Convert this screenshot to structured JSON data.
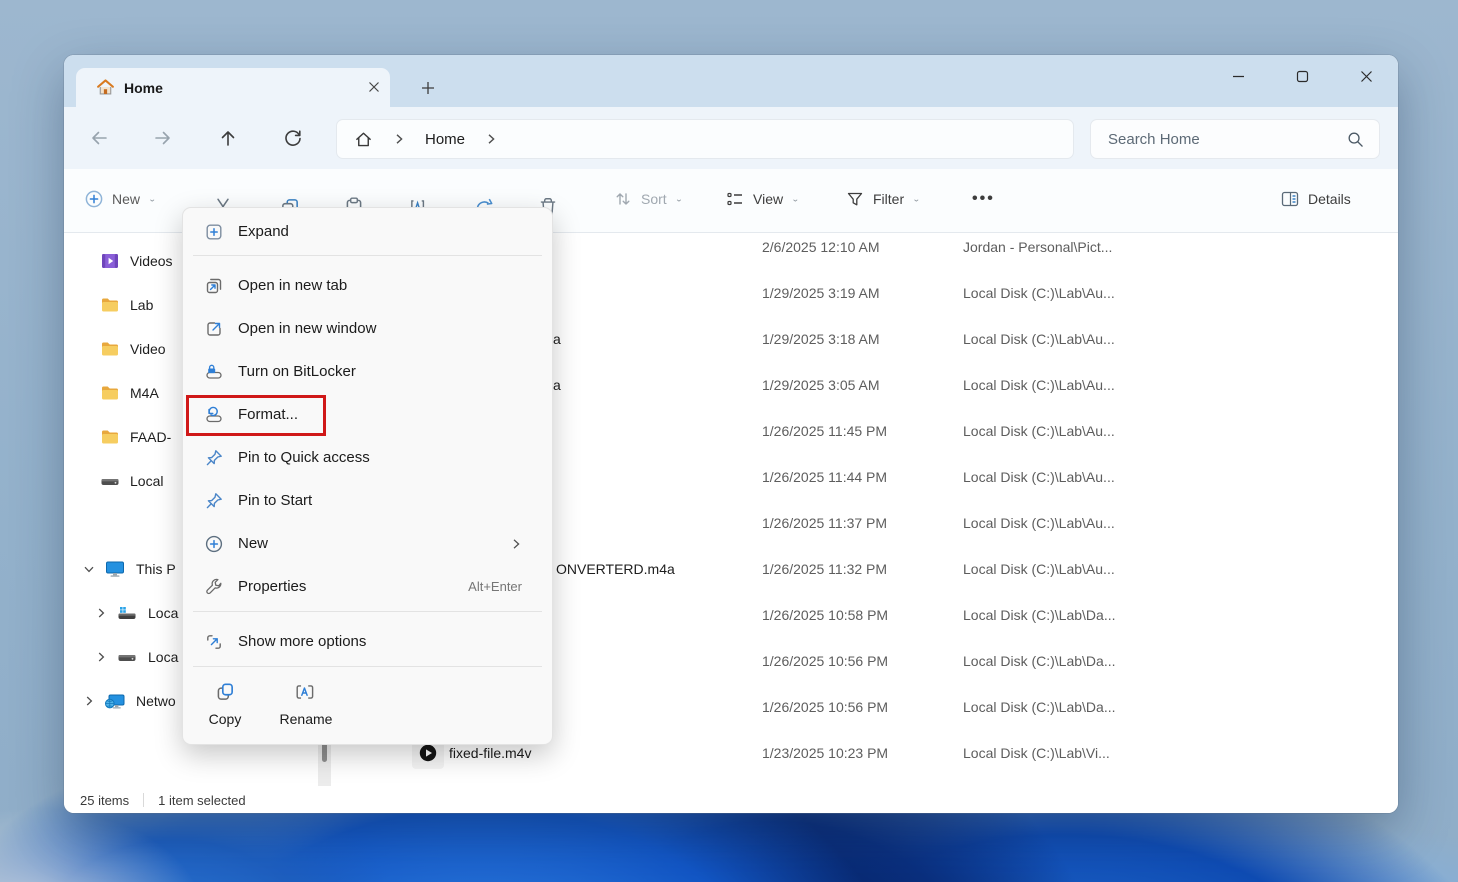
{
  "colors": {
    "accent_blue": "#2f7fd6",
    "highlight_red": "#d01818",
    "folder_yellow": "#f6cd60"
  },
  "titlebar": {
    "tab_label": "Home"
  },
  "navbar": {
    "breadcrumb_root": "Home",
    "search_placeholder": "Search Home"
  },
  "toolbar": {
    "new_label": "New",
    "sort_label": "Sort",
    "view_label": "View",
    "filter_label": "Filter",
    "more_label": "•••",
    "details_label": "Details"
  },
  "sidebar": {
    "items": [
      {
        "label": "Videos",
        "icon": "videos"
      },
      {
        "label": "Lab",
        "icon": "folder"
      },
      {
        "label": "Video",
        "icon": "folder"
      },
      {
        "label": "M4A",
        "icon": "folder"
      },
      {
        "label": "FAAD-",
        "icon": "folder"
      },
      {
        "label": "Local",
        "icon": "drive"
      },
      {
        "label": "This P",
        "icon": "this-pc"
      },
      {
        "label": "Loca",
        "icon": "drive-os"
      },
      {
        "label": "Loca",
        "icon": "drive"
      },
      {
        "label": "Netwo",
        "icon": "network"
      }
    ]
  },
  "context_menu": {
    "items": [
      {
        "label": "Expand"
      },
      {
        "label": "Open in new tab"
      },
      {
        "label": "Open in new window"
      },
      {
        "label": "Turn on BitLocker"
      },
      {
        "label": "Format..."
      },
      {
        "label": "Pin to Quick access"
      },
      {
        "label": "Pin to Start"
      },
      {
        "label": "New",
        "submenu": "›"
      },
      {
        "label": "Properties",
        "shortcut": "Alt+Enter"
      },
      {
        "label": "Show more options"
      }
    ],
    "copy_label": "Copy",
    "rename_label": "Rename"
  },
  "file_list": {
    "rows": [
      {
        "name": "",
        "date": "2/6/2025 12:10 AM",
        "location": "Jordan - Personal\\Pict..."
      },
      {
        "name": "",
        "date": "1/29/2025 3:19 AM",
        "location": "Local Disk (C:)\\Lab\\Au..."
      },
      {
        "name": "a",
        "date": "1/29/2025 3:18 AM",
        "location": "Local Disk (C:)\\Lab\\Au..."
      },
      {
        "name": "a",
        "date": "1/29/2025 3:05 AM",
        "location": "Local Disk (C:)\\Lab\\Au..."
      },
      {
        "name": "",
        "date": "1/26/2025 11:45 PM",
        "location": "Local Disk (C:)\\Lab\\Au..."
      },
      {
        "name": "",
        "date": "1/26/2025 11:44 PM",
        "location": "Local Disk (C:)\\Lab\\Au..."
      },
      {
        "name": "",
        "date": "1/26/2025 11:37 PM",
        "location": "Local Disk (C:)\\Lab\\Au..."
      },
      {
        "name": "ONVERTERD.m4a",
        "date": "1/26/2025 11:32 PM",
        "location": "Local Disk (C:)\\Lab\\Au..."
      },
      {
        "name": "",
        "date": "1/26/2025 10:58 PM",
        "location": "Local Disk (C:)\\Lab\\Da..."
      },
      {
        "name": "",
        "date": "1/26/2025 10:56 PM",
        "location": "Local Disk (C:)\\Lab\\Da..."
      },
      {
        "name": "",
        "date": "1/26/2025 10:56 PM",
        "location": "Local Disk (C:)\\Lab\\Da..."
      },
      {
        "name": "fixed-file.m4v",
        "date": "1/23/2025 10:23 PM",
        "location": "Local Disk (C:)\\Lab\\Vi..."
      }
    ]
  },
  "statusbar": {
    "count": "25 items",
    "selected": "1 item selected"
  }
}
